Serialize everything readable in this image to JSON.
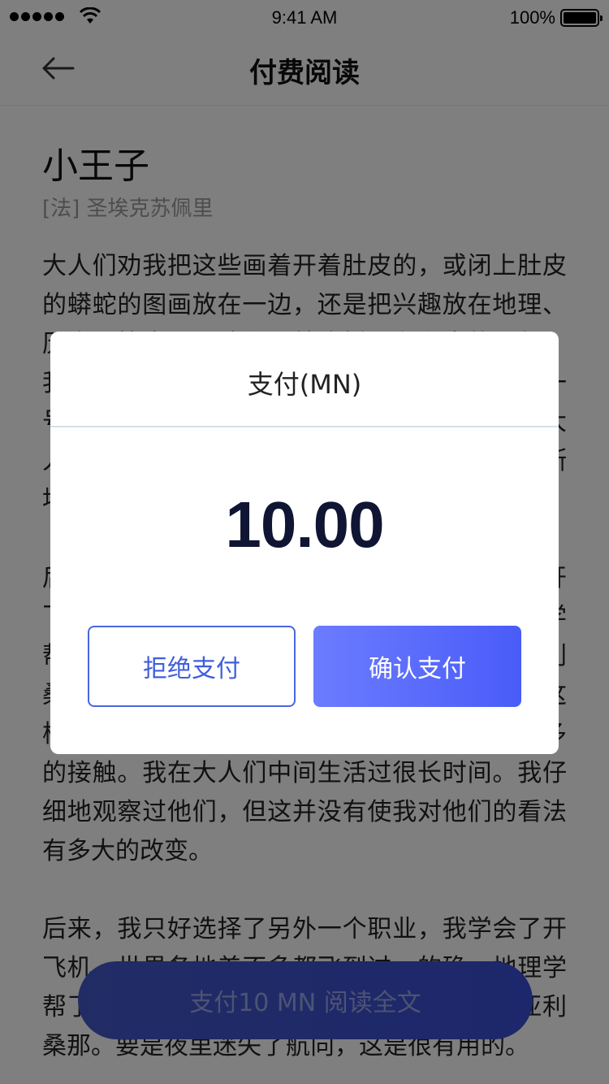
{
  "status_bar": {
    "time": "9:41 AM",
    "battery": "100%",
    "battery_level": 1.0
  },
  "nav": {
    "title": "付费阅读"
  },
  "book": {
    "title": "小王子",
    "author": "[法] 圣埃克苏佩里",
    "paragraphs": [
      "大人们劝我把这些画着开着肚皮的，或闭上肚皮的蟒蛇的图画放在一边，还是把兴趣放在地理、历史、算术、语法上。就这样，在六岁的那年，我就放弃了当画家这一美好的职业。我的第一号、第二号作品的不成功，使我泄了气。这些大人们，靠他们自己什么也弄不懂，还得老是不断地给他们作解释。这真叫孩子们腻味。",
      "后来，我只好选择了另外一个职业，我学会了开飞机，世界各地差不多都飞到过。的确，地理学帮了我很大的忙。我一眼就能分辨出中国和亚利桑那。要是夜里迷失了航向，这是很有用的。这样，在我的生活中，我跟许多严肃的人有过很多的接触。我在大人们中间生活过很长时间。我仔细地观察过他们，但这并没有使我对他们的看法有多大的改变。",
      "后来，我只好选择了另外一个职业，我学会了开飞机，世界各地差不多都飞到过。的确，地理学帮了我很大的忙。我一眼就能分辨出中国和亚利桑那。要是夜里迷失了航向，这是很有用的。"
    ]
  },
  "pay_bar": {
    "label": "支付10 MN 阅读全文"
  },
  "dialog": {
    "title": "支付(MN)",
    "amount": "10.00",
    "reject_label": "拒绝支付",
    "confirm_label": "确认支付"
  },
  "colors": {
    "accent": "#4a5cf8",
    "reject_border": "#4a66e0",
    "amount_text": "#0f1533",
    "overlay": "rgba(0,0,0,0.5)"
  },
  "icons": {
    "back": "arrow-left-icon",
    "wifi": "wifi-icon",
    "battery": "battery-icon",
    "signal": "signal-icon"
  }
}
